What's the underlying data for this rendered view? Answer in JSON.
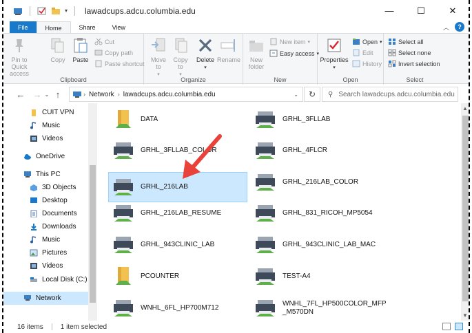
{
  "window": {
    "title": "lawadcups.adcu.columbia.edu",
    "minimize_glyph": "—",
    "maximize_glyph": "☐",
    "close_glyph": "✕"
  },
  "tabs": [
    {
      "label": "File"
    },
    {
      "label": "Home"
    },
    {
      "label": "Share"
    },
    {
      "label": "View"
    }
  ],
  "ribbon": {
    "clipboard": {
      "label": "Clipboard",
      "pin": "Pin to Quick access",
      "copy": "Copy",
      "paste": "Paste",
      "cut": "Cut",
      "copy_path": "Copy path",
      "paste_shortcut": "Paste shortcut"
    },
    "organize": {
      "label": "Organize",
      "move_to": "Move to",
      "copy_to": "Copy to",
      "delete": "Delete",
      "rename": "Rename"
    },
    "new": {
      "label": "New",
      "new_folder": "New folder",
      "new_item": "New item",
      "easy_access": "Easy access"
    },
    "open": {
      "label": "Open",
      "properties": "Properties",
      "open": "Open",
      "edit": "Edit",
      "history": "History"
    },
    "select": {
      "label": "Select",
      "select_all": "Select all",
      "select_none": "Select none",
      "invert": "Invert selection"
    }
  },
  "address": {
    "crumbs": [
      "Network",
      "lawadcups.adcu.columbia.edu"
    ],
    "search_placeholder": "Search lawadcups.adcu.columbia.edu"
  },
  "nav": [
    {
      "label": "CUIT VPN",
      "icon": "folder-icon"
    },
    {
      "label": "Music",
      "icon": "music-icon"
    },
    {
      "label": "Videos",
      "icon": "videos-icon"
    },
    {
      "label": "OneDrive",
      "icon": "onedrive-icon"
    },
    {
      "label": "This PC",
      "icon": "pc-icon"
    },
    {
      "label": "3D Objects",
      "icon": "3d-objects-icon"
    },
    {
      "label": "Desktop",
      "icon": "desktop-icon"
    },
    {
      "label": "Documents",
      "icon": "documents-icon"
    },
    {
      "label": "Downloads",
      "icon": "downloads-icon"
    },
    {
      "label": "Music",
      "icon": "music-icon"
    },
    {
      "label": "Pictures",
      "icon": "pictures-icon"
    },
    {
      "label": "Videos",
      "icon": "videos-icon"
    },
    {
      "label": "Local Disk (C:)",
      "icon": "disk-icon"
    },
    {
      "label": "Network",
      "icon": "network-icon"
    }
  ],
  "items": [
    {
      "label": "DATA",
      "type": "folder"
    },
    {
      "label": "GRHL_3FLLAB",
      "type": "printer"
    },
    {
      "label": "GRHL_3FLLAB_COLOR",
      "type": "printer"
    },
    {
      "label": "GRHL_4FLCR",
      "type": "printer"
    },
    {
      "label": "GRHL_216LAB",
      "type": "printer"
    },
    {
      "label": "GRHL_216LAB_COLOR",
      "type": "printer"
    },
    {
      "label": "GRHL_216LAB_RESUME",
      "type": "printer"
    },
    {
      "label": "GRHL_831_RICOH_MP5054",
      "type": "printer"
    },
    {
      "label": "GRHL_943CLINIC_LAB",
      "type": "printer"
    },
    {
      "label": "GRHL_943CLINIC_LAB_MAC",
      "type": "printer"
    },
    {
      "label": "PCOUNTER",
      "type": "folder"
    },
    {
      "label": "TEST-A4",
      "type": "printer"
    },
    {
      "label": "WNHL_6FL_HP700M712",
      "type": "printer"
    },
    {
      "label": "WNHL_7FL_HP500COLOR_MFP_M570DN",
      "type": "printer"
    }
  ],
  "status": {
    "count": "16 items",
    "selected": "1 item selected"
  },
  "colors": {
    "accent": "#1979ca",
    "selection": "#cce8ff",
    "annotation_arrow": "#e8423a"
  }
}
